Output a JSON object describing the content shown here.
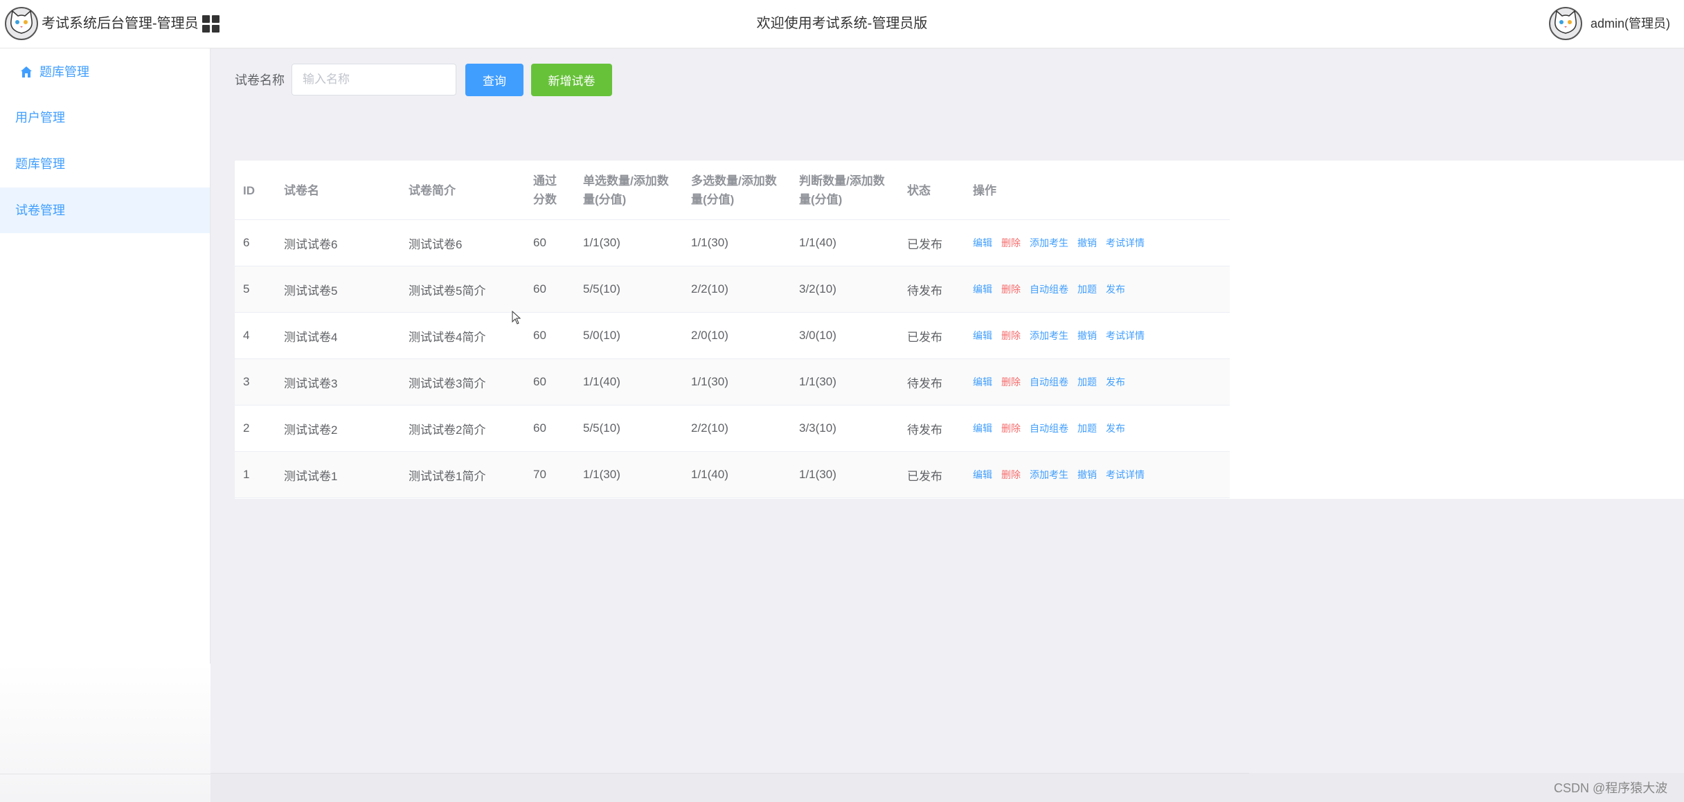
{
  "header": {
    "app_title": "考试系统后台管理-管理员",
    "welcome": "欢迎使用考试系统-管理员版",
    "user_name": "admin(管理员)"
  },
  "sidebar": {
    "head_label": "题库管理",
    "items": [
      {
        "label": "用户管理",
        "active": false
      },
      {
        "label": "题库管理",
        "active": false
      },
      {
        "label": "试卷管理",
        "active": true
      }
    ]
  },
  "search": {
    "label": "试卷名称",
    "placeholder": "输入名称",
    "value": "",
    "query_button": "查询",
    "add_button": "新增试卷"
  },
  "table": {
    "columns": [
      "ID",
      "试卷名",
      "试卷简介",
      "通过分数",
      "单选数量/添加数量(分值)",
      "多选数量/添加数量(分值)",
      "判断数量/添加数量(分值)",
      "状态",
      "操作"
    ],
    "rows": [
      {
        "id": "6",
        "name": "测试试卷6",
        "intro": "测试试卷6",
        "pass": "60",
        "single": "1/1(30)",
        "multi": "1/1(30)",
        "judge": "1/1(40)",
        "status": "已发布",
        "actions": [
          "编辑",
          "删除",
          "添加考生",
          "撤销",
          "考试详情"
        ]
      },
      {
        "id": "5",
        "name": "测试试卷5",
        "intro": "测试试卷5简介",
        "pass": "60",
        "single": "5/5(10)",
        "multi": "2/2(10)",
        "judge": "3/2(10)",
        "status": "待发布",
        "actions": [
          "编辑",
          "删除",
          "自动组卷",
          "加题",
          "发布"
        ]
      },
      {
        "id": "4",
        "name": "测试试卷4",
        "intro": "测试试卷4简介",
        "pass": "60",
        "single": "5/0(10)",
        "multi": "2/0(10)",
        "judge": "3/0(10)",
        "status": "已发布",
        "actions": [
          "编辑",
          "删除",
          "添加考生",
          "撤销",
          "考试详情"
        ]
      },
      {
        "id": "3",
        "name": "测试试卷3",
        "intro": "测试试卷3简介",
        "pass": "60",
        "single": "1/1(40)",
        "multi": "1/1(30)",
        "judge": "1/1(30)",
        "status": "待发布",
        "actions": [
          "编辑",
          "删除",
          "自动组卷",
          "加题",
          "发布"
        ]
      },
      {
        "id": "2",
        "name": "测试试卷2",
        "intro": "测试试卷2简介",
        "pass": "60",
        "single": "5/5(10)",
        "multi": "2/2(10)",
        "judge": "3/3(10)",
        "status": "待发布",
        "actions": [
          "编辑",
          "删除",
          "自动组卷",
          "加题",
          "发布"
        ]
      },
      {
        "id": "1",
        "name": "测试试卷1",
        "intro": "测试试卷1简介",
        "pass": "70",
        "single": "1/1(30)",
        "multi": "1/1(40)",
        "judge": "1/1(30)",
        "status": "已发布",
        "actions": [
          "编辑",
          "删除",
          "添加考生",
          "撤销",
          "考试详情"
        ]
      }
    ]
  },
  "watermark": "CSDN @程序猿大波",
  "colors": {
    "primary": "#409eff",
    "success": "#67c23a",
    "danger": "#f56c6c"
  },
  "icons": {
    "logo": "cat-logo-icon",
    "menu": "grid-menu-icon",
    "home": "home-icon",
    "avatar": "cat-avatar-icon"
  }
}
